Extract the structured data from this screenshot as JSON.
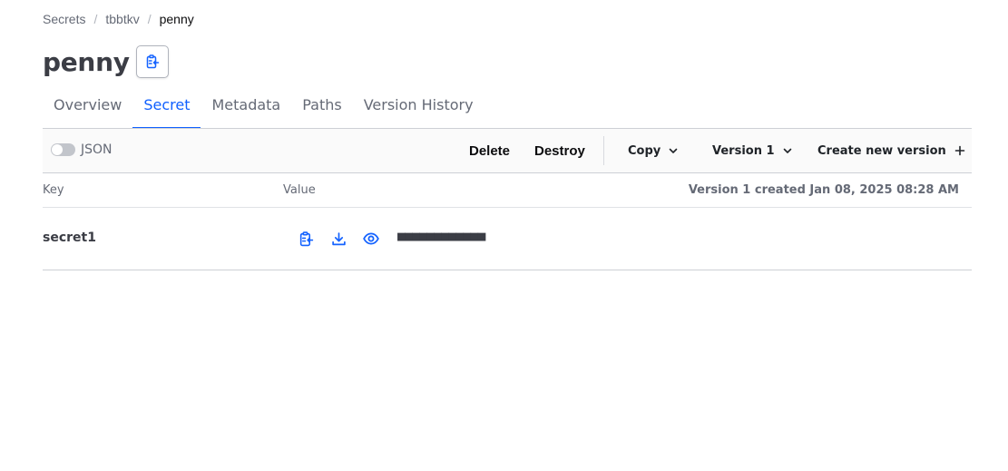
{
  "breadcrumb": {
    "items": [
      {
        "label": "Secrets"
      },
      {
        "label": "tbbtkv"
      }
    ],
    "current": "penny",
    "separator": "/"
  },
  "header": {
    "title": "penny",
    "copy_icon": "clipboard-copy-icon"
  },
  "tabs": [
    {
      "label": "Overview",
      "active": false
    },
    {
      "label": "Secret",
      "active": true
    },
    {
      "label": "Metadata",
      "active": false
    },
    {
      "label": "Paths",
      "active": false
    },
    {
      "label": "Version History",
      "active": false
    }
  ],
  "toolbar": {
    "json_label": "JSON",
    "json_enabled": false,
    "delete_label": "Delete",
    "destroy_label": "Destroy",
    "copy_label": "Copy",
    "version_label": "Version 1",
    "create_label": "Create new version"
  },
  "table": {
    "columns": {
      "key": "Key",
      "value": "Value"
    },
    "version_info": "Version 1 created Jan 08, 2025 08:28 AM",
    "rows": [
      {
        "key": "secret1",
        "masked_value": "■■■■■■■■■■■■"
      }
    ]
  },
  "colors": {
    "accent": "#1060ff",
    "icon_blue": "#1563ff",
    "muted_text": "#656a76"
  }
}
